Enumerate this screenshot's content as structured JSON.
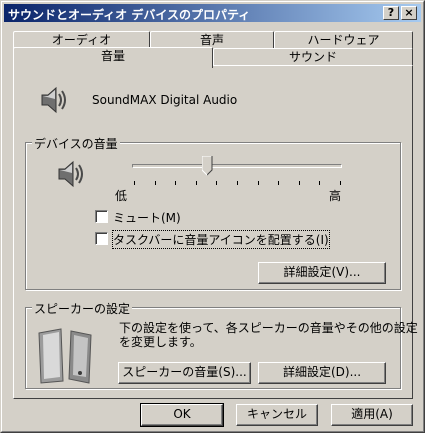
{
  "window": {
    "title": "サウンドとオーディオ デバイスのプロパティ",
    "help_glyph": "?",
    "close_glyph": "×"
  },
  "tabs": [
    {
      "label": "オーディオ"
    },
    {
      "label": "音声"
    },
    {
      "label": "ハードウェア"
    },
    {
      "label": "音量",
      "active": true
    },
    {
      "label": "サウンド"
    }
  ],
  "device": {
    "name": "SoundMAX Digital Audio",
    "icon": "speaker-icon"
  },
  "device_volume": {
    "group_title": "デバイスの音量",
    "slider_min_label": "低",
    "slider_max_label": "高",
    "slider_level": 0.35,
    "mute_label": "ミュート(M)",
    "mute_checked": false,
    "taskbar_label": "タスクバーに音量アイコンを配置する(I)",
    "taskbar_checked": false,
    "advanced_button": "詳細設定(V)..."
  },
  "speaker_settings": {
    "group_title": "スピーカーの設定",
    "description_line1": "下の設定を使って、各スピーカーの音量やその他の設定",
    "description_line2": "を変更します。",
    "speaker_volume_button": "スピーカーの音量(S)...",
    "advanced_button": "詳細設定(D)..."
  },
  "footer": {
    "ok": "OK",
    "cancel": "キャンセル",
    "apply": "適用(A)"
  },
  "colors": {
    "face": "#d4d0c8",
    "title_start": "#0a246a",
    "title_end": "#a6caf0"
  }
}
